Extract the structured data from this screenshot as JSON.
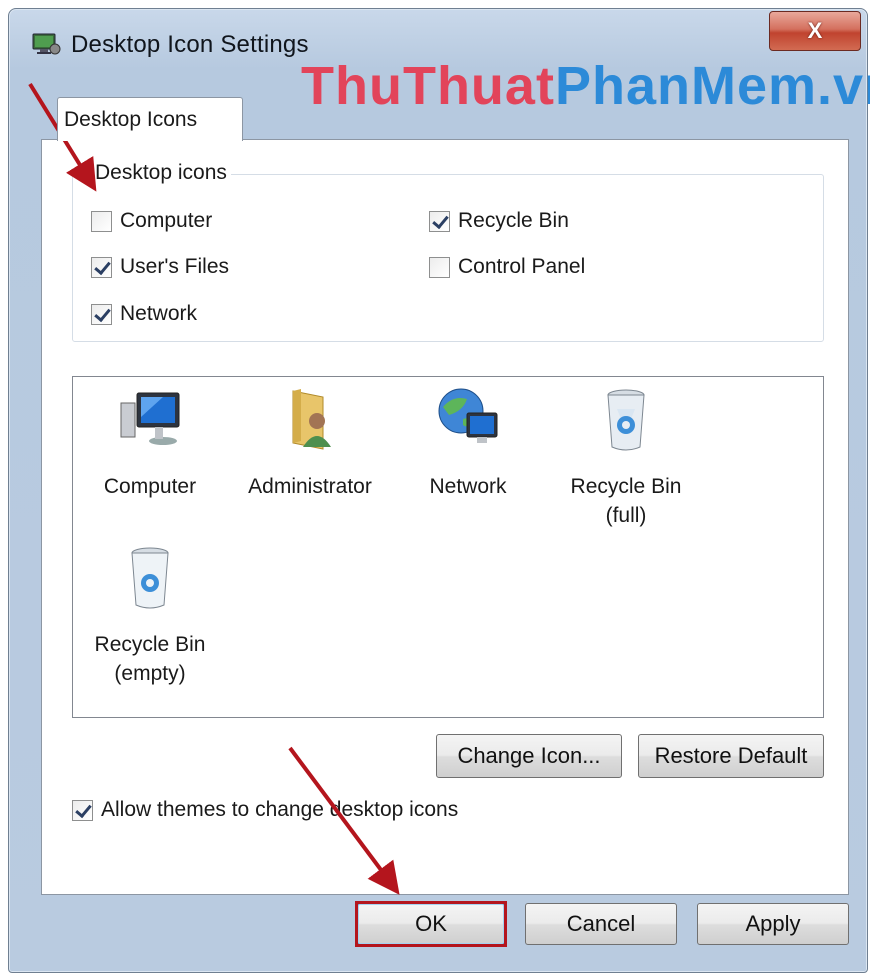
{
  "window": {
    "title": "Desktop Icon Settings",
    "close_label": "X"
  },
  "watermark": {
    "part1": "ThuThuat",
    "part2": "PhanMem.vn"
  },
  "tabs": [
    {
      "label": "Desktop Icons"
    }
  ],
  "desktop_icons_group": {
    "legend": "Desktop icons",
    "checkboxes": [
      {
        "label": "Computer",
        "checked": false
      },
      {
        "label": "Recycle Bin",
        "checked": true
      },
      {
        "label": "User's Files",
        "checked": true
      },
      {
        "label": "Control Panel",
        "checked": false
      },
      {
        "label": "Network",
        "checked": true
      }
    ]
  },
  "icon_list": [
    {
      "label": "Computer",
      "icon": "computer-icon"
    },
    {
      "label": "Administrator",
      "icon": "user-folder-icon"
    },
    {
      "label": "Network",
      "icon": "network-icon"
    },
    {
      "label": "Recycle Bin\n(full)",
      "icon": "recycle-bin-full-icon"
    },
    {
      "label": "Recycle Bin\n(empty)",
      "icon": "recycle-bin-empty-icon"
    }
  ],
  "icon_buttons": {
    "change_icon": "Change Icon...",
    "restore_default": "Restore Default"
  },
  "allow_themes": {
    "label": "Allow themes to change desktop icons",
    "checked": true
  },
  "footer_buttons": {
    "ok": "OK",
    "cancel": "Cancel",
    "apply": "Apply"
  },
  "colors": {
    "annotation_red": "#b4151d",
    "watermark_pink": "#e2445a",
    "watermark_blue": "#2c8ad8"
  }
}
